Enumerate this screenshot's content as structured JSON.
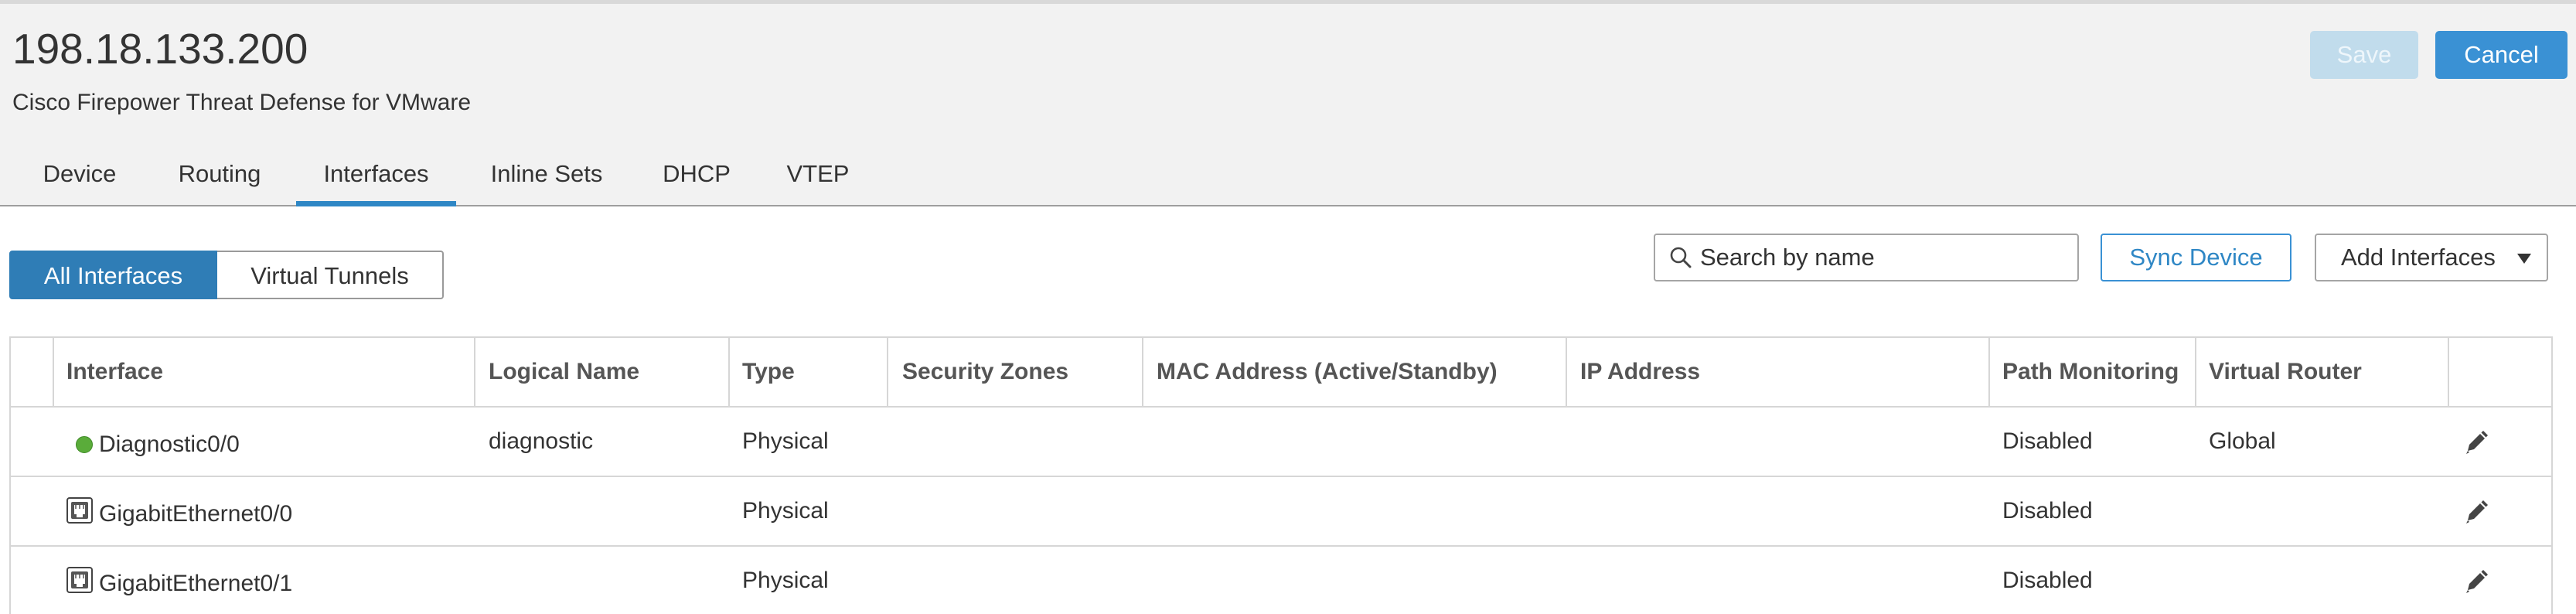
{
  "header": {
    "title": "198.18.133.200",
    "subtitle": "Cisco Firepower Threat Defense for VMware",
    "save_label": "Save",
    "cancel_label": "Cancel"
  },
  "tabs": [
    {
      "label": "Device",
      "active": false
    },
    {
      "label": "Routing",
      "active": false
    },
    {
      "label": "Interfaces",
      "active": true
    },
    {
      "label": "Inline Sets",
      "active": false
    },
    {
      "label": "DHCP",
      "active": false
    },
    {
      "label": "VTEP",
      "active": false
    }
  ],
  "view_toggle": {
    "all_interfaces": "All Interfaces",
    "virtual_tunnels": "Virtual Tunnels"
  },
  "toolbar": {
    "search_placeholder": "Search by name",
    "sync_label": "Sync Device",
    "add_label": "Add Interfaces"
  },
  "table": {
    "columns": [
      "Interface",
      "Logical Name",
      "Type",
      "Security Zones",
      "MAC Address (Active/Standby)",
      "IP Address",
      "Path Monitoring",
      "Virtual Router"
    ],
    "rows": [
      {
        "icon": "status-dot-icon",
        "interface": "Diagnostic0/0",
        "logical_name": "diagnostic",
        "type": "Physical",
        "security_zones": "",
        "mac": "",
        "ip": "",
        "path_monitoring": "Disabled",
        "virtual_router": "Global"
      },
      {
        "icon": "ethernet-port-icon",
        "interface": "GigabitEthernet0/0",
        "logical_name": "",
        "type": "Physical",
        "security_zones": "",
        "mac": "",
        "ip": "",
        "path_monitoring": "Disabled",
        "virtual_router": ""
      },
      {
        "icon": "ethernet-port-icon",
        "interface": "GigabitEthernet0/1",
        "logical_name": "",
        "type": "Physical",
        "security_zones": "",
        "mac": "",
        "ip": "",
        "path_monitoring": "Disabled",
        "virtual_router": ""
      }
    ]
  },
  "colors": {
    "accent": "#2f87c5",
    "cancel_button": "#3a91d4",
    "save_button_disabled": "#c1dcec",
    "status_up": "#5aac3a"
  }
}
